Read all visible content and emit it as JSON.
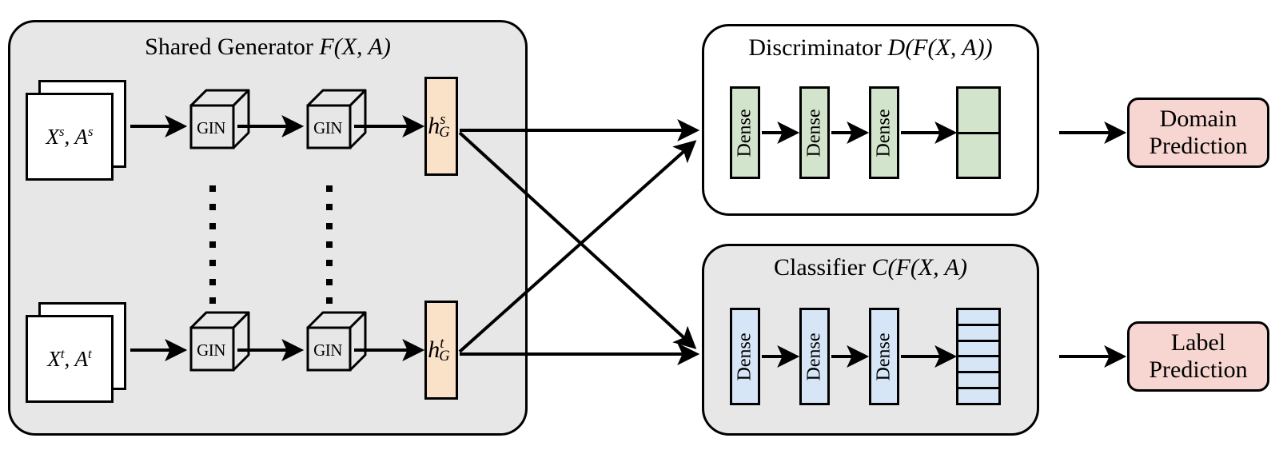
{
  "diagram": {
    "title": "Shared Generator / Discriminator / Classifier adversarial domain adaptation architecture",
    "colors": {
      "panel_gray": "#e7e7e7",
      "panel_white": "#ffffff",
      "embedding_orange": "#fae2c8",
      "dense_green": "#d3e4cd",
      "dense_blue": "#d7e6f7",
      "prediction_pink": "#f7d6d1",
      "stroke": "#000000"
    }
  },
  "generator": {
    "title": "Shared Generator ",
    "title_math": "F(X, A)",
    "source_row": {
      "input_label_base": "X",
      "input_label_sup1": "s",
      "input_label_mid": ", A",
      "input_label_sup2": "s",
      "input_label_plain": "Xˢ, Aˢ",
      "blocks": [
        "GIN",
        "GIN"
      ],
      "embedding_base": "h",
      "embedding_sup": "s",
      "embedding_sub": "G",
      "embedding_plain": "h_G^s"
    },
    "target_row": {
      "input_label_base": "X",
      "input_label_sup1": "t",
      "input_label_mid": ", A",
      "input_label_sup2": "t",
      "input_label_plain": "Xᵗ, Aᵗ",
      "blocks": [
        "GIN",
        "GIN"
      ],
      "embedding_base": "h",
      "embedding_sup": "t",
      "embedding_sub": "G",
      "embedding_plain": "h_G^t"
    },
    "ellipsis_dot_count": 7
  },
  "discriminator": {
    "title": "Discriminator ",
    "title_math": "D(F(X, A))",
    "dense_layers": [
      "Dense",
      "Dense",
      "Dense"
    ],
    "output_cells": 2
  },
  "classifier": {
    "title": "Classifier ",
    "title_math": "C(F(X, A)",
    "dense_layers": [
      "Dense",
      "Dense",
      "Dense"
    ],
    "output_cells": 6
  },
  "predictions": {
    "domain": {
      "line1": "Domain",
      "line2": "Prediction"
    },
    "label": {
      "line1": "Label",
      "line2": "Prediction"
    }
  }
}
